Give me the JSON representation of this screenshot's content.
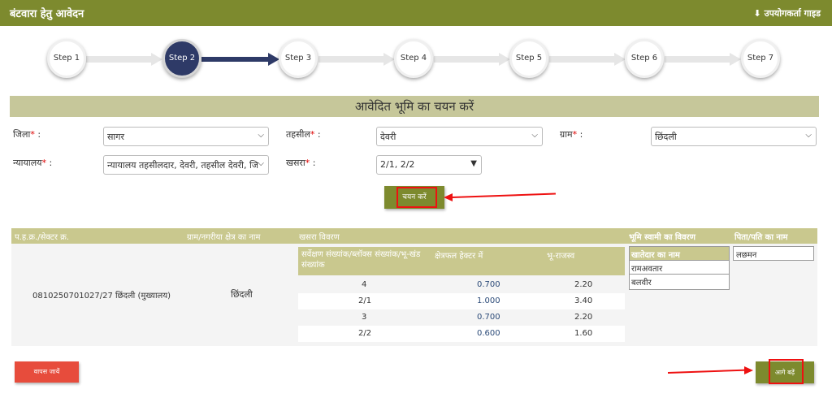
{
  "header": {
    "title": "बंटवारा हेतु आवेदन",
    "guide_label": "उपयोगकर्ता गाइड"
  },
  "steps": [
    "Step 1",
    "Step 2",
    "Step 3",
    "Step 4",
    "Step 5",
    "Step 6",
    "Step 7"
  ],
  "current_step": 2,
  "section_title": "आवेदित भूमि का चयन करें",
  "form": {
    "district": {
      "label": "जिला",
      "value": "सागर"
    },
    "tehsil": {
      "label": "तहसील",
      "value": "देवरी"
    },
    "village": {
      "label": "ग्राम",
      "value": "छिंदली"
    },
    "court": {
      "label": "न्यायालय",
      "value": "न्यायालय तहसीलदार, देवरी, तहसील देवरी, जि"
    },
    "khasra": {
      "label": "खसरा",
      "value": "2/1, 2/2"
    },
    "select_button": "चयन करें"
  },
  "table": {
    "headers": {
      "ph_sector": "प.ह.क्र./सेक्टर क्र.",
      "village_name": "ग्राम/नगरीया क्षेत्र का नाम",
      "khasra_details": "खसरा विवरण",
      "owner_details": "भूमि स्वामी का विवरण",
      "father_name": "पिता/पति का नाम"
    },
    "khasra_columns": [
      "सर्वेक्षण संख्यांक/ब्लॉक्स संख्यांक/भू-खंड संख्यांक",
      "क्षेत्रफल हेक्टर में",
      "भू-राजस्व"
    ],
    "ph_value": "0810250701027/27 छिंदली (मुख्यालय)",
    "village_value": "छिंदली",
    "khasra_rows": [
      {
        "survey": "4",
        "area": "0.700",
        "revenue": "2.20"
      },
      {
        "survey": "2/1",
        "area": "1.000",
        "revenue": "3.40"
      },
      {
        "survey": "3",
        "area": "0.700",
        "revenue": "2.20"
      },
      {
        "survey": "2/2",
        "area": "0.600",
        "revenue": "1.60"
      }
    ],
    "owner_header": "खातेदार का नाम",
    "owners": [
      "रामअवतार",
      "बलवीर"
    ],
    "father": "लछमन"
  },
  "buttons": {
    "back": "वापस जायें",
    "next": "आगे बढ़ें"
  },
  "colors": {
    "header": "#7d8a2e",
    "step_active": "#2e3a67",
    "section": "#c6c79a",
    "table_head": "#c9c88e",
    "annotation": "#e11111",
    "back_button": "#e74c3c"
  }
}
